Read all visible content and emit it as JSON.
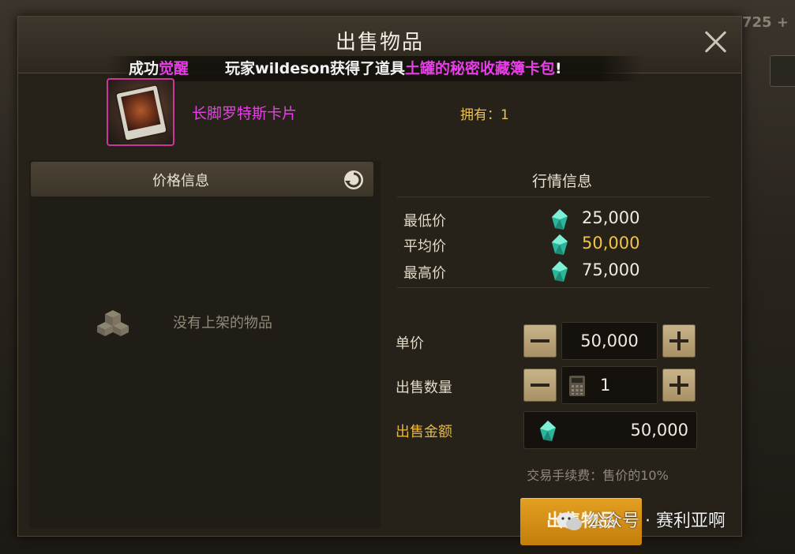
{
  "background": {
    "topbar_text": "725 +"
  },
  "dialog": {
    "title": "出售物品",
    "close_icon": "close-icon"
  },
  "broadcast": {
    "prefix": "成功",
    "prefix_highlight": "觉醒",
    "message_start": "玩家wildeson获得了道具",
    "message_item": "土罐的秘密收藏簿卡包",
    "message_end": "!"
  },
  "item": {
    "name": "长脚罗特斯卡片",
    "owned": "拥有：1",
    "rarity_color": "#e442e4"
  },
  "price_info": {
    "tab_label": "价格信息",
    "refresh_icon": "refresh-icon",
    "empty_text": "没有上架的物品",
    "empty_icon": "empty-box-icon"
  },
  "market_info": {
    "title": "行情信息",
    "rows": [
      {
        "label": "最低价",
        "value": "25,000"
      },
      {
        "label": "平均价",
        "value": "50,000"
      },
      {
        "label": "最高价",
        "value": "75,000"
      }
    ],
    "currency_icon": "gem-icon"
  },
  "sell_form": {
    "unit_price_label": "单价",
    "unit_price_value": "50,000",
    "quantity_label": "出售数量",
    "quantity_value": "1",
    "total_label": "出售金额",
    "total_value": "50,000",
    "fee_text": "交易手续费：售价的10%",
    "sell_button": "出售物品"
  },
  "watermark": {
    "text": "公众号 · 赛利亚啊"
  },
  "colors": {
    "accent_gold": "#f1c34a",
    "sell_button": "#d98f14",
    "magenta": "#e83ee8"
  }
}
